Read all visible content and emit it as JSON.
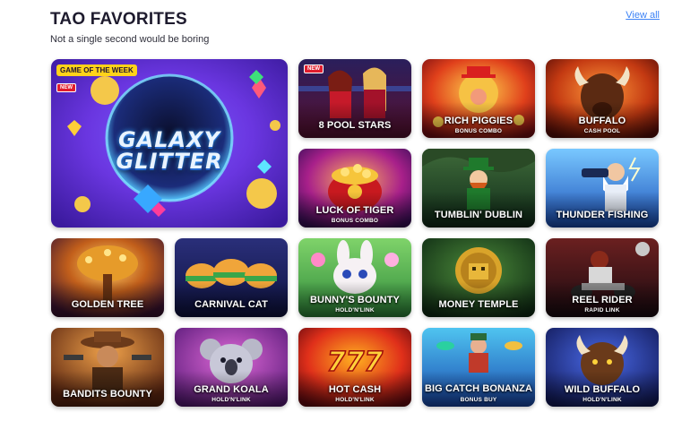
{
  "header": {
    "title": "TAO FAVORITES",
    "subtitle": "Not a single second would be boring",
    "view_all": "View all"
  },
  "featured": {
    "badge": "GAME OF THE WEEK",
    "new_badge": "NEW",
    "name_line1": "GALAXY",
    "name_line2": "GLITTER"
  },
  "games": [
    {
      "name": "8 POOL STARS",
      "sub": "",
      "new": "NEW"
    },
    {
      "name": "RICH PIGGIES",
      "sub": "BONUS COMBO"
    },
    {
      "name": "BUFFALO",
      "sub": "CASH POOL"
    },
    {
      "name": "LUCK OF TIGER",
      "sub": "BONUS COMBO"
    },
    {
      "name": "TUMBLIN' DUBLIN",
      "sub": ""
    },
    {
      "name": "THUNDER FISHING",
      "sub": ""
    },
    {
      "name": "GOLDEN TREE",
      "sub": ""
    },
    {
      "name": "CARNIVAL CAT",
      "sub": ""
    },
    {
      "name": "BUNNY'S BOUNTY",
      "sub": "HOLD'N'LINK"
    },
    {
      "name": "MONEY TEMPLE",
      "sub": ""
    },
    {
      "name": "REEL RIDER",
      "sub": "RAPID LINK"
    },
    {
      "name": "BANDITS BOUNTY",
      "sub": ""
    },
    {
      "name": "GRAND KOALA",
      "sub": "HOLD'N'LINK"
    },
    {
      "name": "HOT CASH",
      "sub": "HOLD'N'LINK"
    },
    {
      "name": "BIG CATCH BONANZA",
      "sub": "BONUS BUY"
    },
    {
      "name": "WILD BUFFALO",
      "sub": "HOLD'N'LINK"
    }
  ],
  "colors": {
    "link": "#3b82f6",
    "badge_yellow": "#ffd21a",
    "badge_red": "#e11d2e"
  }
}
